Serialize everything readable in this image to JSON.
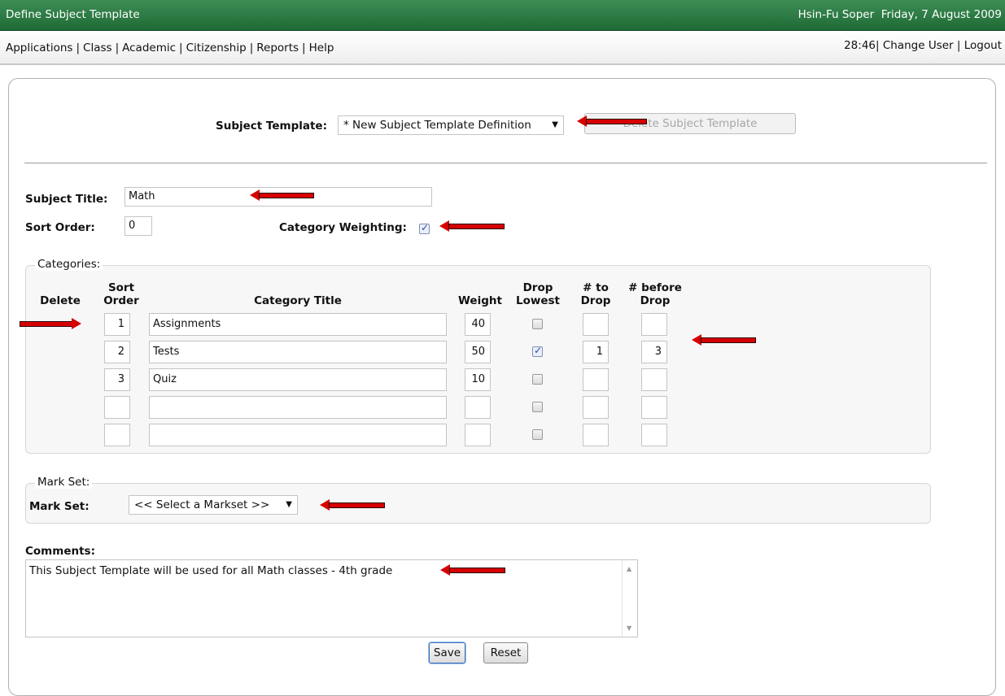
{
  "window": {
    "title": "Define Subject Template",
    "user": "Hsin-Fu Soper",
    "date": "Friday, 7 August 2009"
  },
  "menu": {
    "items": [
      "Applications",
      "Class",
      "Academic",
      "Citizenship",
      "Reports",
      "Help"
    ],
    "timer": "28:46",
    "change_user": "Change User",
    "logout": "Logout"
  },
  "template_selector": {
    "label": "Subject Template:",
    "selected": "* New Subject Template Definition",
    "delete_button": "Delete Subject Template"
  },
  "subject": {
    "title_label": "Subject Title:",
    "title_value": "Math",
    "sort_label": "Sort Order:",
    "sort_value": "0",
    "weighting_label": "Category Weighting:",
    "weighting_checked": true
  },
  "categories": {
    "legend": "Categories:",
    "headers": {
      "delete": "Delete",
      "sort_order": "Sort Order",
      "title": "Category Title",
      "weight": "Weight",
      "drop_lowest": "Drop Lowest",
      "to_drop": "# to Drop",
      "before_drop": "# before Drop"
    },
    "rows": [
      {
        "sort": "1",
        "title": "Assignments",
        "weight": "40",
        "drop_lowest": false,
        "to_drop": "",
        "before_drop": ""
      },
      {
        "sort": "2",
        "title": "Tests",
        "weight": "50",
        "drop_lowest": true,
        "to_drop": "1",
        "before_drop": "3"
      },
      {
        "sort": "3",
        "title": "Quiz",
        "weight": "10",
        "drop_lowest": false,
        "to_drop": "",
        "before_drop": ""
      },
      {
        "sort": "",
        "title": "",
        "weight": "",
        "drop_lowest": false,
        "to_drop": "",
        "before_drop": ""
      },
      {
        "sort": "",
        "title": "",
        "weight": "",
        "drop_lowest": false,
        "to_drop": "",
        "before_drop": ""
      }
    ]
  },
  "markset": {
    "legend": "Mark Set:",
    "label": "Mark Set:",
    "selected": "<< Select a Markset >>"
  },
  "comments": {
    "label": "Comments:",
    "value": "This Subject Template will be used for all Math classes - 4th grade"
  },
  "actions": {
    "save": "Save",
    "reset": "Reset"
  },
  "colors": {
    "titlebar": "#2a7a44",
    "arrow": "#d60000"
  }
}
